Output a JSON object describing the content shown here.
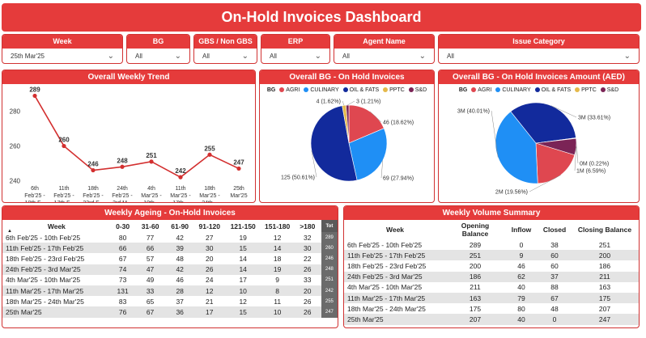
{
  "header": {
    "title": "On-Hold Invoices Dashboard"
  },
  "filters": [
    {
      "label": "Week",
      "value": "25th Mar'25"
    },
    {
      "label": "BG",
      "value": "All"
    },
    {
      "label": "GBS / Non GBS",
      "value": "All"
    },
    {
      "label": "ERP",
      "value": "All"
    },
    {
      "label": "Agent Name",
      "value": "All"
    },
    {
      "label": "Issue Category",
      "value": "All"
    }
  ],
  "trend": {
    "title": "Overall Weekly Trend",
    "chart_data": {
      "type": "line",
      "categories": [
        "6th Feb'25 - 10th F...",
        "11th Feb'25 - 17th F...",
        "18th Feb'25 - 23rd F...",
        "24th Feb'25 - 3rd M...",
        "4th Mar'25 - 10th...",
        "11th Mar'25 - 17th...",
        "18th Mar'25 - 24th...",
        "25th Mar'25"
      ],
      "values": [
        289,
        260,
        246,
        248,
        251,
        242,
        255,
        247
      ],
      "yticks": [
        240,
        260,
        280
      ],
      "ylim": [
        236,
        292
      ],
      "color": "#d32f2f"
    }
  },
  "bg_count": {
    "title": "Overall BG - On Hold Invoices",
    "legend_title": "BG",
    "chart_data": {
      "type": "pie",
      "labels": [
        "AGRI",
        "CULINARY",
        "OIL & FATS",
        "PPTC",
        "S&D"
      ],
      "values": [
        46,
        69,
        125,
        4,
        3
      ],
      "data_labels": [
        "46 (18.62%)",
        "69 (27.94%)",
        "125 (50.61%)",
        "4 (1.62%)",
        "3 (1.21%)"
      ],
      "colors": [
        "#df4750",
        "#1f8ff5",
        "#122a9c",
        "#e5b94a",
        "#7b2456"
      ]
    }
  },
  "bg_amount": {
    "title": "Overall BG - On Hold Invoices Amount (AED)",
    "legend_title": "BG",
    "chart_data": {
      "type": "pie",
      "labels": [
        "AGRI",
        "CULINARY",
        "OIL & FATS",
        "PPTC",
        "S&D"
      ],
      "values": [
        19.56,
        40.01,
        33.61,
        0.22,
        6.59
      ],
      "data_labels": [
        "2M (19.56%)",
        "3M (40.01%)",
        "3M (33.61%)",
        "0M (0.22%)",
        "1M (6.59%)"
      ],
      "colors": [
        "#df4750",
        "#1f8ff5",
        "#122a9c",
        "#e5b94a",
        "#7b2456"
      ]
    }
  },
  "ageing": {
    "title": "Weekly Ageing - On-Hold Invoices",
    "columns": [
      "Week",
      "0-30",
      "31-60",
      "61-90",
      "91-120",
      "121-150",
      "151-180",
      ">180",
      "Tot"
    ],
    "rows": [
      [
        "6th Feb'25 - 10th Feb'25",
        "80",
        "77",
        "42",
        "27",
        "19",
        "12",
        "32",
        "289"
      ],
      [
        "11th Feb'25 - 17th Feb'25",
        "66",
        "66",
        "39",
        "30",
        "15",
        "14",
        "30",
        "260"
      ],
      [
        "18th Feb'25 - 23rd Feb'25",
        "67",
        "57",
        "48",
        "20",
        "14",
        "18",
        "22",
        "246"
      ],
      [
        "24th Feb'25 - 3rd Mar'25",
        "74",
        "47",
        "42",
        "26",
        "14",
        "19",
        "26",
        "248"
      ],
      [
        "4th Mar'25 - 10th Mar'25",
        "73",
        "49",
        "46",
        "24",
        "17",
        "9",
        "33",
        "251"
      ],
      [
        "11th Mar'25 - 17th Mar'25",
        "131",
        "33",
        "28",
        "12",
        "10",
        "8",
        "20",
        "242"
      ],
      [
        "18th Mar'25 - 24th Mar'25",
        "83",
        "65",
        "37",
        "21",
        "12",
        "11",
        "26",
        "255"
      ],
      [
        "25th Mar'25",
        "76",
        "67",
        "36",
        "17",
        "15",
        "10",
        "26",
        "247"
      ]
    ]
  },
  "volume": {
    "title": "Weekly Volume Summary",
    "columns": [
      "Week",
      "Opening Balance",
      "Inflow",
      "Closed",
      "Closing Balance"
    ],
    "rows": [
      [
        "6th Feb'25 - 10th Feb'25",
        "289",
        "0",
        "38",
        "251"
      ],
      [
        "11th Feb'25 - 17th Feb'25",
        "251",
        "9",
        "60",
        "200"
      ],
      [
        "18th Feb'25 - 23rd Feb'25",
        "200",
        "46",
        "60",
        "186"
      ],
      [
        "24th Feb'25 - 3rd Mar'25",
        "186",
        "62",
        "37",
        "211"
      ],
      [
        "4th Mar'25 - 10th Mar'25",
        "211",
        "40",
        "88",
        "163"
      ],
      [
        "11th Mar'25 - 17th Mar'25",
        "163",
        "79",
        "67",
        "175"
      ],
      [
        "18th Mar'25 - 24th Mar'25",
        "175",
        "80",
        "48",
        "207"
      ],
      [
        "25th Mar'25",
        "207",
        "40",
        "0",
        "247"
      ]
    ]
  }
}
